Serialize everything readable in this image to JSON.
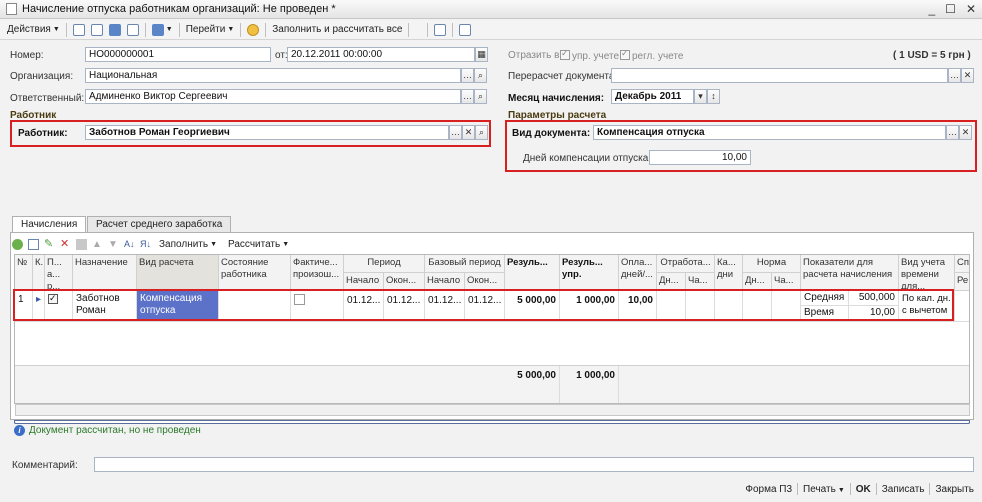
{
  "window": {
    "title": "Начисление отпуска работникам организаций: Не проведен *",
    "min": "_",
    "max": "☐",
    "close": "✕"
  },
  "toolbar": {
    "actions": "Действия",
    "go": "Перейти",
    "fill_calc": "Заполнить и рассчитать все"
  },
  "header": {
    "number_label": "Номер:",
    "number": "НО000000001",
    "date_label": "от:",
    "date": "20.12.2011 00:00:00",
    "reflect_label": "Отразить в:",
    "mgmt_label": "упр. учете",
    "reg_label": "регл. учете",
    "rate": "( 1 USD = 5 грн )",
    "org_label": "Организация:",
    "org": "Национальная",
    "recalc_label": "Перерасчет документа:",
    "recalc": "",
    "resp_label": "Ответственный:",
    "resp": "Админенко Виктор Сергеевич",
    "month_label": "Месяц начисления:",
    "month": "Декабрь 2011"
  },
  "worker_section": {
    "title": "Работник",
    "label": "Работник:",
    "value": "Заботнов Роман Георгиевич"
  },
  "params_section": {
    "title": "Параметры расчета",
    "doc_type_label": "Вид документа:",
    "doc_type": "Компенсация отпуска",
    "days_label": "Дней компенсации отпуска:",
    "days": "10,00"
  },
  "tabs": [
    "Начисления",
    "Расчет среднего заработка"
  ],
  "grid_toolbar": {
    "fill": "Заполнить",
    "calc": "Рассчитать"
  },
  "grid": {
    "headers": {
      "n": "№",
      "k": "К...",
      "p": "П... а... р...",
      "name": "Назначение",
      "calc_type": "Вид расчета",
      "state": "Состояние работника",
      "actual": "Фактиче... произош...",
      "period": "Период",
      "period_start": "Начало",
      "period_end": "Окон...",
      "base": "Базовый период",
      "base_start": "Начало",
      "base_end": "Окон...",
      "result": "Резуль...",
      "result_mgmt": "Резуль... упр.",
      "paid_days": "Опла... дней/...",
      "worked": "Отработа...",
      "worked_d": "Дн...",
      "worked_h": "Ча...",
      "cal_days": "Ка... дни",
      "norm": "Норма",
      "norm_d": "Дн...",
      "norm_h": "Ча...",
      "indicators": "Показатели для расчета начисления",
      "time_acc": "Вид учета времени для...",
      "extra1": "Сп...",
      "extra2": "Ре..."
    },
    "row": {
      "n": "1",
      "name": "Заботнов Роман",
      "calc_type": "Компенсация отпуска",
      "state": "",
      "period_start": "01.12...",
      "period_end": "01.12...",
      "base_start": "01.12...",
      "base_end": "01.12...",
      "result": "5 000,00",
      "result_mgmt": "1 000,00",
      "paid_days": "10,00",
      "ind1_name": "Средняя",
      "ind1_value": "500,000",
      "ind2_name": "Время",
      "ind2_value": "10,00",
      "time_acc": "По кал. дн. с вычетом"
    },
    "totals": {
      "result": "5 000,00",
      "result_mgmt": "1 000,00"
    }
  },
  "status": "Документ рассчитан, но не проведен",
  "comment_label": "Комментарий:",
  "comment": "",
  "bottom": {
    "form": "Форма П3",
    "print": "Печать",
    "ok": "OK",
    "save": "Записать",
    "close": "Закрыть"
  }
}
